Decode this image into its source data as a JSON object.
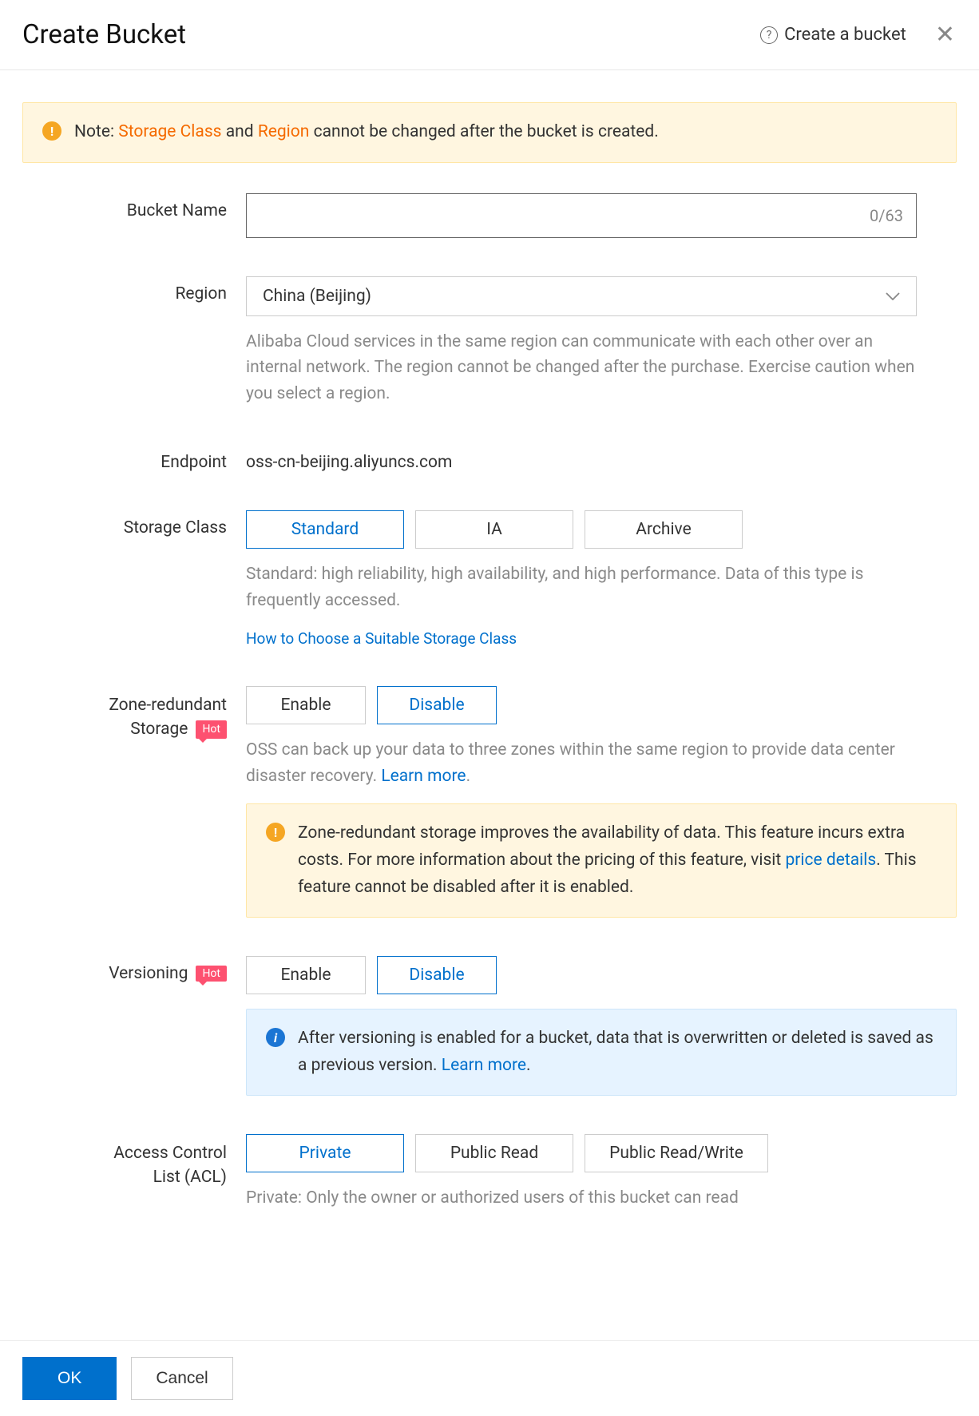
{
  "header": {
    "title": "Create Bucket",
    "help_link": "Create a bucket"
  },
  "top_alert": {
    "prefix": "Note: ",
    "hl1": "Storage Class",
    "mid": " and ",
    "hl2": "Region",
    "suffix": " cannot be changed after the bucket is created."
  },
  "bucket_name": {
    "label": "Bucket Name",
    "counter": "0/63"
  },
  "region": {
    "label": "Region",
    "value": "China (Beijing)",
    "help": "Alibaba Cloud services in the same region can communicate with each other over an internal network. The region cannot be changed after the purchase. Exercise caution when you select a region."
  },
  "endpoint": {
    "label": "Endpoint",
    "value": "oss-cn-beijing.aliyuncs.com"
  },
  "storage_class": {
    "label": "Storage Class",
    "options": [
      {
        "label": "Standard",
        "selected": true
      },
      {
        "label": "IA",
        "selected": false
      },
      {
        "label": "Archive",
        "selected": false
      }
    ],
    "help": "Standard: high reliability, high availability, and high performance. Data of this type is frequently accessed.",
    "link": "How to Choose a Suitable Storage Class"
  },
  "zrs": {
    "label_line1": "Zone-redundant",
    "label_line2": "Storage",
    "badge": "Hot",
    "options": [
      {
        "label": "Enable",
        "selected": false
      },
      {
        "label": "Disable",
        "selected": true
      }
    ],
    "help_pre": "OSS can back up your data to three zones within the same region to provide data center disaster recovery. ",
    "help_link": "Learn more",
    "alert_pre": "Zone-redundant storage improves the availability of data. This feature incurs extra costs. For more information about the pricing of this feature, visit ",
    "alert_link": "price details",
    "alert_post": ". This feature cannot be disabled after it is enabled."
  },
  "versioning": {
    "label": "Versioning",
    "badge": "Hot",
    "options": [
      {
        "label": "Enable",
        "selected": false
      },
      {
        "label": "Disable",
        "selected": true
      }
    ],
    "alert_pre": "After versioning is enabled for a bucket, data that is overwritten or deleted is saved as a previous version. ",
    "alert_link": "Learn more"
  },
  "acl": {
    "label_line1": "Access Control",
    "label_line2": "List (ACL)",
    "options": [
      {
        "label": "Private",
        "selected": true
      },
      {
        "label": "Public Read",
        "selected": false
      },
      {
        "label": "Public Read/Write",
        "selected": false
      }
    ],
    "help": "Private: Only the owner or authorized users of this bucket can read"
  },
  "footer": {
    "ok": "OK",
    "cancel": "Cancel"
  }
}
